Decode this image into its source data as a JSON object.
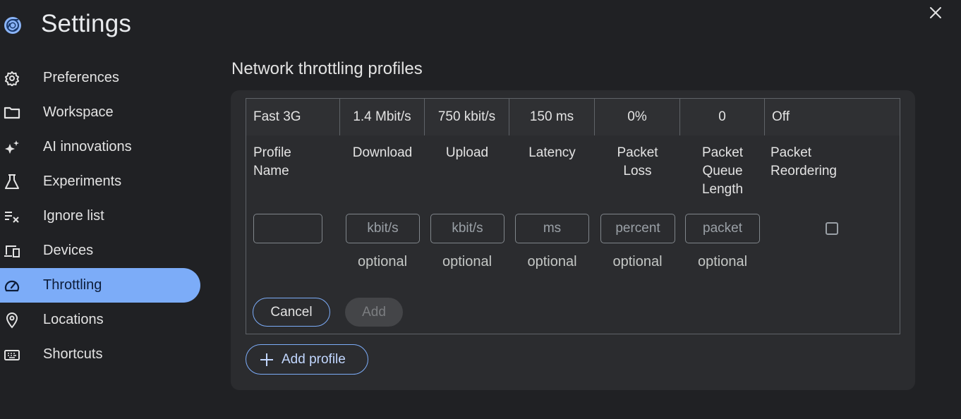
{
  "header": {
    "title": "Settings",
    "logo_icon": "chrome-devtools-logo",
    "close_icon": "close-icon"
  },
  "sidebar": {
    "items": [
      {
        "label": "Preferences",
        "icon": "gear-icon",
        "active": false
      },
      {
        "label": "Workspace",
        "icon": "folder-icon",
        "active": false
      },
      {
        "label": "AI innovations",
        "icon": "sparkle-icon",
        "active": false
      },
      {
        "label": "Experiments",
        "icon": "flask-icon",
        "active": false
      },
      {
        "label": "Ignore list",
        "icon": "ignore-list-icon",
        "active": false
      },
      {
        "label": "Devices",
        "icon": "devices-icon",
        "active": false
      },
      {
        "label": "Throttling",
        "icon": "speedometer-icon",
        "active": true
      },
      {
        "label": "Locations",
        "icon": "location-pin-icon",
        "active": false
      },
      {
        "label": "Shortcuts",
        "icon": "keyboard-icon",
        "active": false
      }
    ]
  },
  "main": {
    "section_title": "Network throttling profiles",
    "profile_row": {
      "name": "Fast 3G",
      "download": "1.4 Mbit/s",
      "upload": "750 kbit/s",
      "latency": "150 ms",
      "packet_loss": "0%",
      "packet_queue_length": "0",
      "packet_reordering": "Off"
    },
    "headers": {
      "profile_name_1": "Profile",
      "profile_name_2": "Name",
      "download": "Download",
      "upload": "Upload",
      "latency": "Latency",
      "packet_loss_1": "Packet",
      "packet_loss_2": "Loss",
      "queue_1": "Packet",
      "queue_2": "Queue",
      "queue_3": "Length",
      "reorder_1": "Packet",
      "reorder_2": "Reordering"
    },
    "inputs": {
      "profile_name_value": "",
      "download_placeholder": "kbit/s",
      "upload_placeholder": "kbit/s",
      "latency_placeholder": "ms",
      "packet_loss_placeholder": "percent",
      "queue_placeholder": "packet",
      "reordering_checked": false
    },
    "optional_label": "optional",
    "buttons": {
      "cancel": "Cancel",
      "add": "Add",
      "add_profile": "Add profile"
    }
  },
  "colors": {
    "background": "#202124",
    "card": "#2b2c2f",
    "accent": "#7cacf8",
    "active_nav": "#7cacf8"
  }
}
